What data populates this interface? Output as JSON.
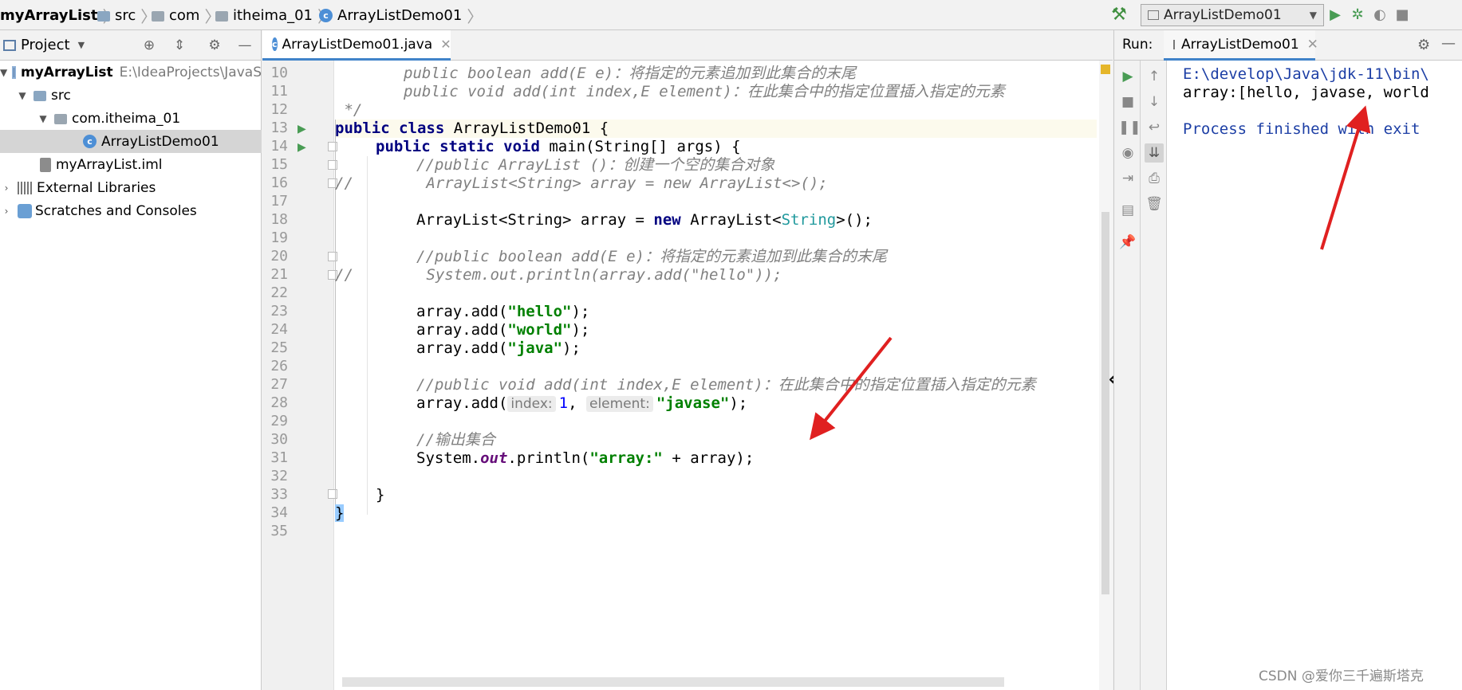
{
  "breadcrumb": {
    "project": "myArrayList",
    "items": [
      "src",
      "com",
      "itheima_01",
      "ArrayListDemo01"
    ]
  },
  "toolbar": {
    "run_config": "ArrayListDemo01"
  },
  "project_panel": {
    "title": "Project",
    "tree": [
      {
        "label": "myArrayList",
        "path": "E:\\IdeaProjects\\JavaS"
      },
      {
        "label": "src"
      },
      {
        "label": "com.itheima_01"
      },
      {
        "label": "ArrayListDemo01"
      },
      {
        "label": "myArrayList.iml"
      },
      {
        "label": "External Libraries"
      },
      {
        "label": "Scratches and Consoles"
      }
    ]
  },
  "editor": {
    "tab_label": "ArrayListDemo01.java",
    "line_numbers": [
      "10",
      "11",
      "12",
      "13",
      "14",
      "15",
      "16",
      "17",
      "18",
      "19",
      "20",
      "21",
      "22",
      "23",
      "24",
      "25",
      "26",
      "27",
      "28",
      "29",
      "30",
      "31",
      "32",
      "33",
      "34",
      "35"
    ],
    "code": {
      "l10": "public boolean add(E e)：将指定的元素追加到此集合的末尾",
      "l11": "public void add(int index,E element)：在此集合中的指定位置插入指定的元素",
      "l12": " */",
      "l13_kw": "public class",
      "l13_name": " ArrayListDemo01 ",
      "l13_brace": "{",
      "l14_kw": "public static void",
      "l14_rest": " main(String[] args) {",
      "l15": "//public ArrayList ()：创建一个空的集合对象",
      "l16": "//        ArrayList<String> array = new ArrayList<>();",
      "l18_a": "ArrayList<String> array = ",
      "l18_kw": "new",
      "l18_b": " ArrayList<",
      "l18_c": "String",
      "l18_d": ">();",
      "l20": "//public boolean add(E e)：将指定的元素追加到此集合的末尾",
      "l21": "//        System.out.println(array.add(\"hello\"));",
      "l23_pre": "array.add(",
      "l23_str": "\"hello\"",
      "l24_str": "\"world\"",
      "l25_str": "\"java\"",
      "post": ");",
      "l27": "//public void add(int index,E element)：在此集合中的指定位置插入指定的元素",
      "l28_pre": "array.add(",
      "l28_hint1": "index:",
      "l28_num": "1",
      "l28_comma": ", ",
      "l28_hint2": "element:",
      "l28_str": "\"javase\"",
      "l30": "//输出集合",
      "l31_a": "System.",
      "l31_fld": "out",
      "l31_b": ".println(",
      "l31_str": "\"array:\"",
      "l31_c": " + array);",
      "l33": "}",
      "l34": "}"
    }
  },
  "run_panel": {
    "label": "Run:",
    "tab_label": "ArrayListDemo01",
    "console": [
      "E:\\develop\\Java\\jdk-11\\bin\\",
      "array:[hello, javase, world",
      "",
      "Process finished with exit"
    ]
  },
  "watermark": "CSDN @爱你三千遍斯塔克",
  "colors": {
    "keyword": "#000080",
    "string": "#008000",
    "comment": "#808080",
    "annotation_arrow": "#e02020",
    "selection": "#d5d5d5"
  }
}
